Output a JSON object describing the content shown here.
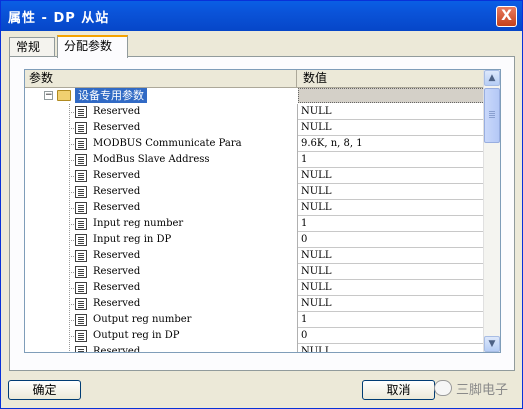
{
  "window": {
    "title": "属性 - DP 从站",
    "close_label": "X"
  },
  "tabs": [
    {
      "label": "常规"
    },
    {
      "label": "分配参数"
    }
  ],
  "grid": {
    "col_param": "参数",
    "col_value": "数值",
    "group_label": "设备专用参数",
    "rows": [
      {
        "name": "Reserved",
        "value": "NULL"
      },
      {
        "name": "Reserved",
        "value": "NULL"
      },
      {
        "name": "MODBUS Communicate Para",
        "value": "9.6K, n, 8, 1"
      },
      {
        "name": "ModBus Slave Address",
        "value": "1"
      },
      {
        "name": "Reserved",
        "value": "NULL"
      },
      {
        "name": "Reserved",
        "value": "NULL"
      },
      {
        "name": "Reserved",
        "value": "NULL"
      },
      {
        "name": "Input reg number",
        "value": "1"
      },
      {
        "name": "Input reg in DP",
        "value": "0"
      },
      {
        "name": "Reserved",
        "value": "NULL"
      },
      {
        "name": "Reserved",
        "value": "NULL"
      },
      {
        "name": "Reserved",
        "value": "NULL"
      },
      {
        "name": "Reserved",
        "value": "NULL"
      },
      {
        "name": "Output reg number",
        "value": "1"
      },
      {
        "name": "Output reg in DP",
        "value": "0"
      },
      {
        "name": "Reserved",
        "value": "NULL"
      }
    ]
  },
  "buttons": {
    "ok": "确定",
    "cancel": "取消"
  },
  "watermark": {
    "text": "三脚电子"
  },
  "colors": {
    "titlebar": "#0a53d8",
    "selection": "#316ac5",
    "dialog_bg": "#ece9d8"
  }
}
